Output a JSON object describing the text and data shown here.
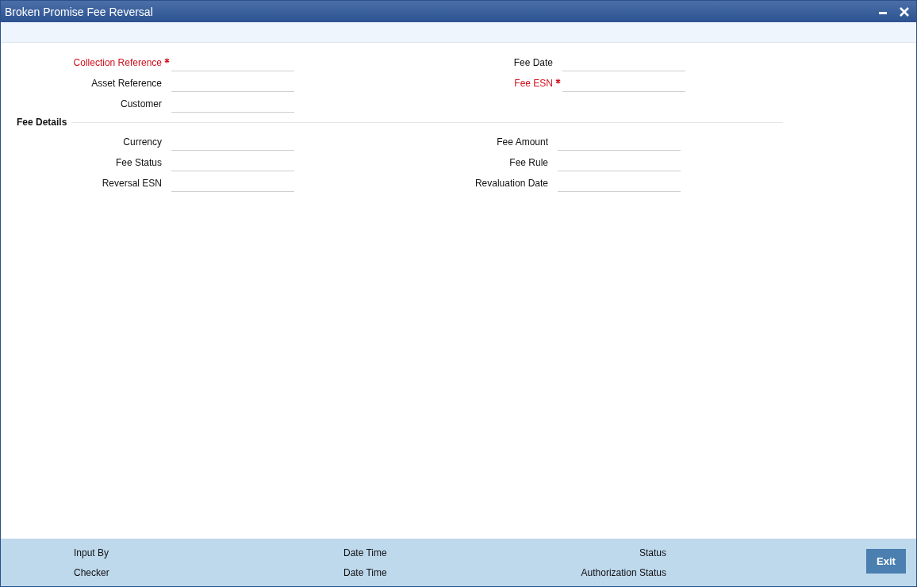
{
  "window": {
    "title": "Broken Promise Fee Reversal"
  },
  "header_fields": [
    {
      "label": "Collection Reference",
      "required": true
    },
    {
      "label": "Fee Date",
      "required": false
    },
    {
      "label": "Asset Reference",
      "required": false
    },
    {
      "label": "Fee ESN",
      "required": true
    },
    {
      "label": "Customer",
      "required": false
    }
  ],
  "fee_details": {
    "title": "Fee Details",
    "fields": [
      {
        "label": "Currency",
        "required": false
      },
      {
        "label": "Fee Amount",
        "required": false
      },
      {
        "label": "Fee Status",
        "required": false
      },
      {
        "label": "Fee Rule",
        "required": false
      },
      {
        "label": "Reversal ESN",
        "required": false
      },
      {
        "label": "Revaluation Date",
        "required": false
      }
    ]
  },
  "footer": {
    "columns": [
      [
        "Input By",
        "Checker"
      ],
      [
        "Date Time",
        "Date Time"
      ],
      [
        "Status",
        "Authorization Status"
      ]
    ],
    "button": "Exit"
  }
}
